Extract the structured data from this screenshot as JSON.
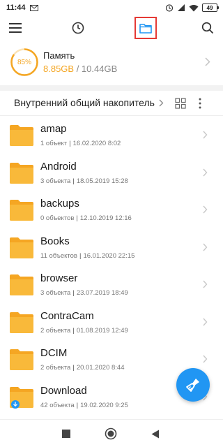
{
  "status_bar": {
    "time": "11:44",
    "battery": "49"
  },
  "toolbar": {
    "menu_icon": "hamburger-menu-icon",
    "history_icon": "clock-icon",
    "folder_icon": "folder-outline-icon",
    "search_icon": "search-icon",
    "accent_color": "#2196f3",
    "highlight_color": "#e53935"
  },
  "storage": {
    "percent_label": "85%",
    "percent": 0.85,
    "title": "Память",
    "used": "8.85GB",
    "separator_total": " / 10.44GB",
    "ring_color": "#f4a623"
  },
  "location": {
    "label": "Внутренний общий накопитель"
  },
  "files": [
    {
      "name": "amap",
      "count": "1 объект",
      "date": "16.02.2020 8:02"
    },
    {
      "name": "Android",
      "count": "3 объекта",
      "date": "18.05.2019 15:28"
    },
    {
      "name": "backups",
      "count": "0 объектов",
      "date": "12.10.2019 12:16"
    },
    {
      "name": "Books",
      "count": "11 объектов",
      "date": "16.01.2020 22:15"
    },
    {
      "name": "browser",
      "count": "3 объекта",
      "date": "23.07.2019 18:49"
    },
    {
      "name": "ContraCam",
      "count": "2 объекта",
      "date": "01.08.2019 12:49"
    },
    {
      "name": "DCIM",
      "count": "2 объекта",
      "date": "20.01.2020 8:44"
    },
    {
      "name": "Download",
      "count": "42 объекта",
      "date": "19.02.2020 9:25"
    }
  ],
  "folder_color": "#f9b93a",
  "fab": {
    "icon": "broom-clean-icon"
  },
  "nav": {
    "recents_icon": "square-icon",
    "home_icon": "circle-icon",
    "back_icon": "triangle-back-icon"
  }
}
